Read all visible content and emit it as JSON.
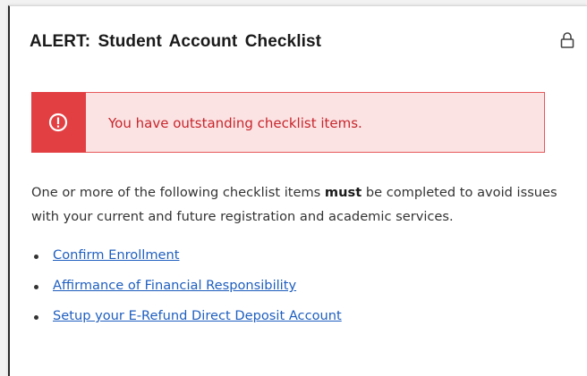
{
  "card": {
    "title": "ALERT: Student Account Checklist"
  },
  "alert": {
    "message": "You have outstanding checklist items.",
    "icon": "exclamation-circle-icon"
  },
  "description": {
    "before": "One or more of the following checklist items ",
    "emphasis": "must",
    "after": " be completed to avoid issues with your current and future registration and academic services."
  },
  "checklist": [
    {
      "label": "Confirm Enrollment"
    },
    {
      "label": "Affirmance of Financial Responsibility"
    },
    {
      "label": "Setup your E-Refund Direct Deposit Account"
    }
  ],
  "colors": {
    "alert_accent": "#e23f43",
    "alert_background": "#fbe3e4",
    "alert_text": "#c8262b",
    "link": "#1f5fbf"
  }
}
